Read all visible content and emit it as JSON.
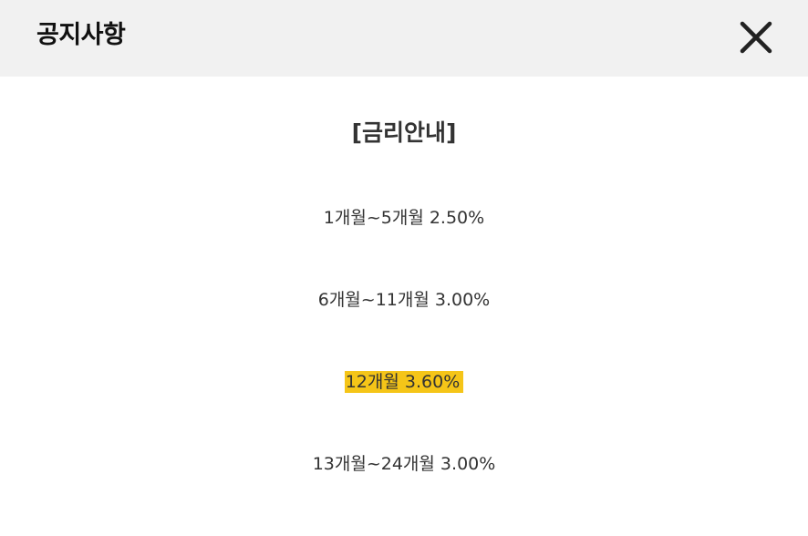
{
  "header": {
    "title": "공지사항",
    "close_icon": "close-icon"
  },
  "notice": {
    "heading": "[금리안내]",
    "rates": [
      {
        "text": "1개월~5개월 2.50%",
        "highlighted": false
      },
      {
        "text": "6개월~11개월 3.00%",
        "highlighted": false
      },
      {
        "text": "12개월 3.60%",
        "highlighted": true
      },
      {
        "text": "13개월~24개월 3.00%",
        "highlighted": false
      }
    ]
  },
  "colors": {
    "header_bg": "#f1f1f1",
    "highlight": "#f5c518",
    "text": "#333333"
  }
}
